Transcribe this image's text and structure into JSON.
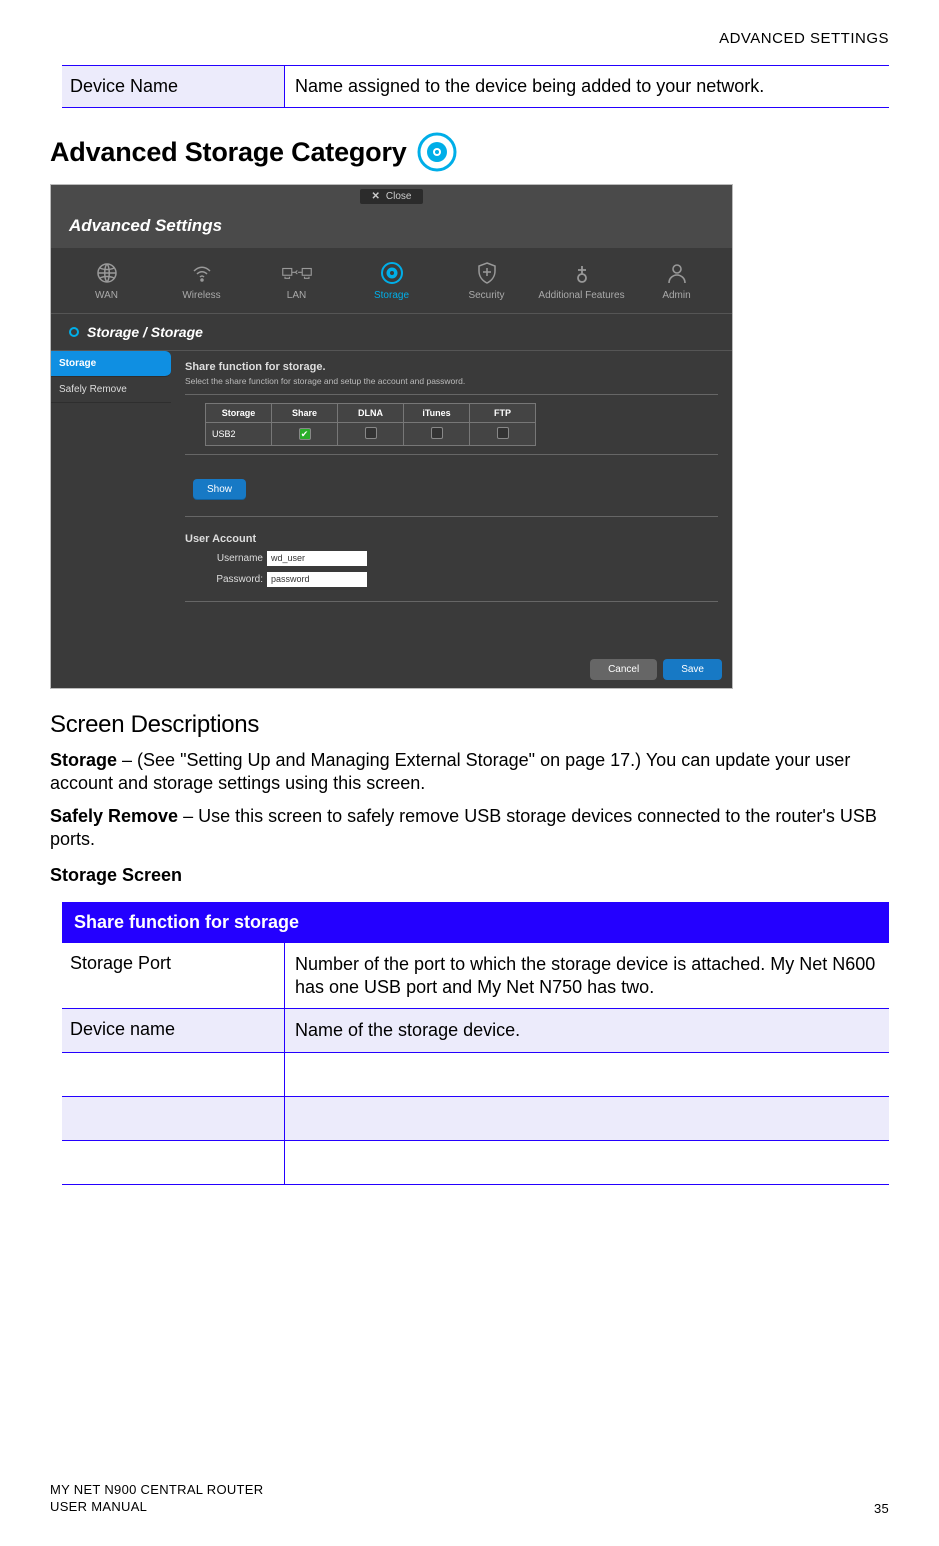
{
  "header": {
    "section": "ADVANCED SETTINGS"
  },
  "top_table": {
    "row1_label": "Device Name",
    "row1_desc": "Name assigned to the device being added to your network."
  },
  "category": {
    "title": "Advanced Storage Category",
    "icon_name": "disc-storage-icon"
  },
  "shot": {
    "close_label": "Close",
    "adv_title": "Advanced Settings",
    "nav": [
      {
        "label": "WAN"
      },
      {
        "label": "Wireless"
      },
      {
        "label": "LAN"
      },
      {
        "label": "Storage",
        "active": true
      },
      {
        "label": "Security"
      },
      {
        "label": "Additional Features"
      },
      {
        "label": "Admin"
      }
    ],
    "breadcrumb": "Storage / Storage",
    "sidebar": [
      {
        "label": "Storage",
        "active": true
      },
      {
        "label": "Safely Remove"
      }
    ],
    "main": {
      "title": "Share function for storage.",
      "sub": "Select the share function for storage and setup the account and password.",
      "table": {
        "headers": [
          "Storage",
          "Share",
          "DLNA",
          "iTunes",
          "FTP"
        ],
        "row_label": "USB2",
        "checks": [
          true,
          false,
          false,
          false
        ]
      },
      "show_btn": "Show",
      "user_account_title": "User Account",
      "username_label": "Username",
      "username_value": "wd_user",
      "password_label": "Password:",
      "password_value": "password"
    },
    "buttons": {
      "cancel": "Cancel",
      "save": "Save"
    }
  },
  "descriptions": {
    "heading": "Screen Descriptions",
    "storage_bold": "Storage",
    "storage_text": " – (See \"Setting Up and Managing External Storage\" on page 17.) You can update your user account and storage settings using this screen.",
    "safely_bold": "Safely Remove",
    "safely_text": " – Use this screen to safely remove USB storage devices connected to the router's USB ports.",
    "storage_screen": "Storage Screen"
  },
  "big_table": {
    "header": "Share function for storage",
    "rows": [
      {
        "label": "Storage Port",
        "desc": "Number of the port to which the storage device is attached. My Net N600 has one USB port and My Net N750 has two.",
        "alt": false
      },
      {
        "label": "Device name",
        "desc": "Name of the storage device.",
        "alt": true
      },
      {
        "label": "",
        "desc": "",
        "alt": false,
        "empty": true
      },
      {
        "label": "",
        "desc": "",
        "alt": true,
        "empty": true
      },
      {
        "label": "",
        "desc": "",
        "alt": false,
        "empty": true
      }
    ]
  },
  "footer": {
    "line1": "MY NET N900 CENTRAL ROUTER",
    "line2": "USER MANUAL",
    "page": "35"
  }
}
